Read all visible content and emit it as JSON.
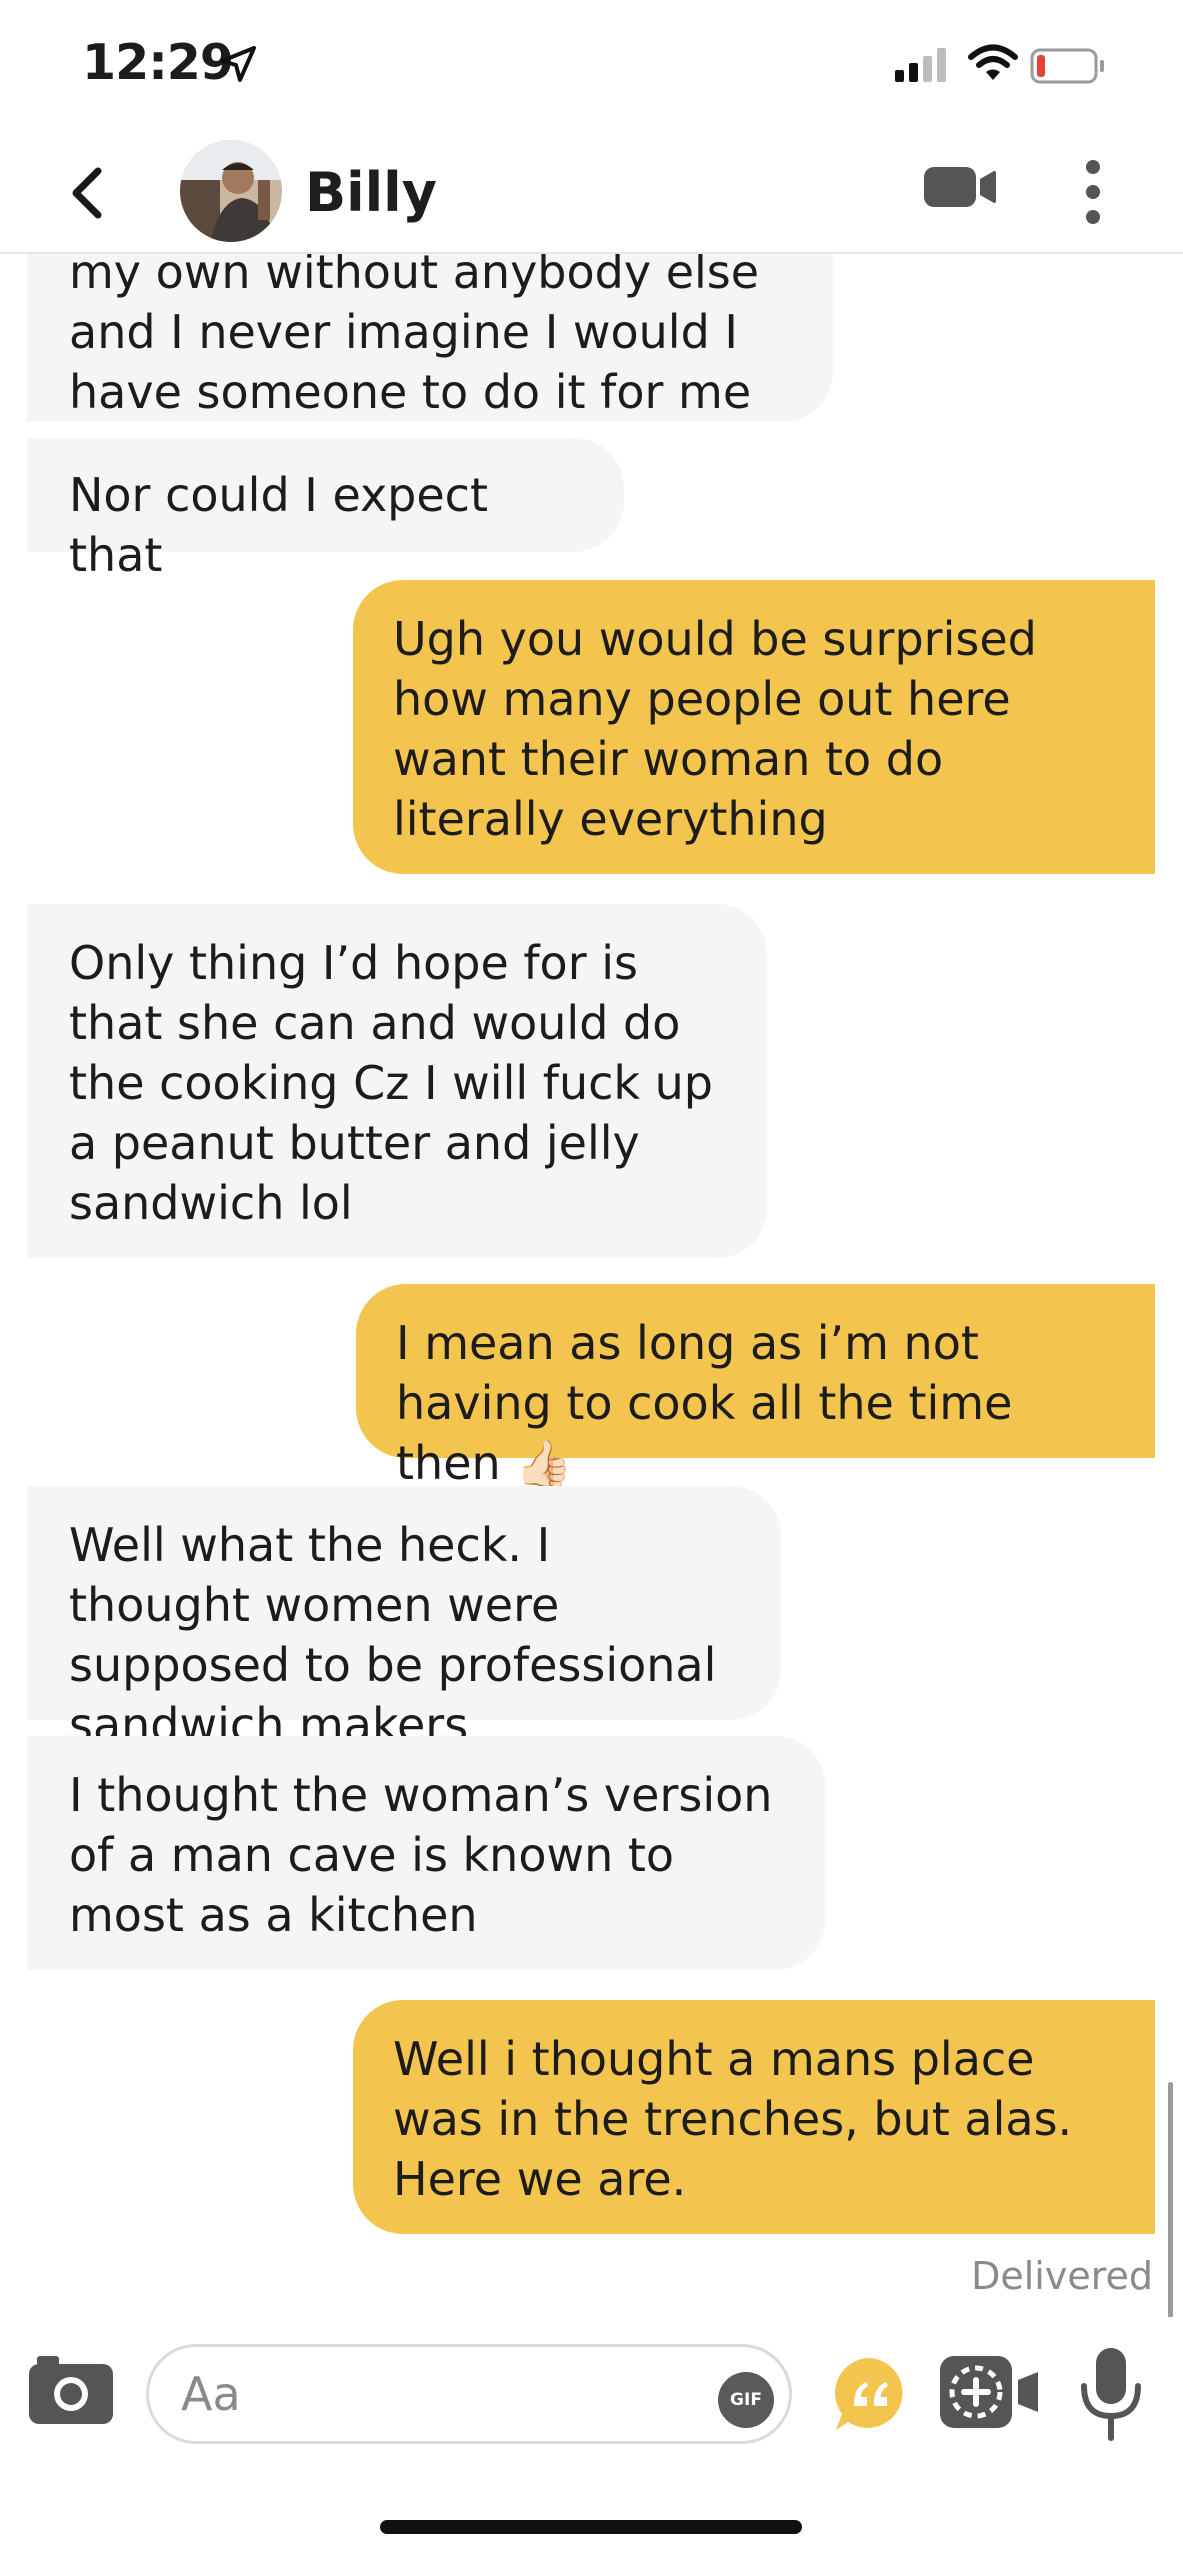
{
  "status_bar": {
    "time": "12:29",
    "icons": [
      "location-arrow-icon",
      "cellular-signal-icon",
      "wifi-icon",
      "battery-low-icon"
    ],
    "battery_color": "#e5433a"
  },
  "header": {
    "contact_name": "Billy",
    "icons": [
      "back-chevron-icon",
      "video-call-icon",
      "more-vertical-icon"
    ]
  },
  "messages": [
    {
      "from": "them",
      "text": "my own without anybody else and I never imagine I would I have someone to do it for me"
    },
    {
      "from": "them",
      "text": "Nor could I expect that"
    },
    {
      "from": "me",
      "text": "Ugh you would be surprised how many people out here want their woman to do literally everything"
    },
    {
      "from": "them",
      "text": "Only thing I’d hope for is that she can and would do the cooking Cz I will fuck up a peanut butter and jelly sandwich lol"
    },
    {
      "from": "me",
      "text": "I mean as long as i’m not having to cook all the time then 👍🏻"
    },
    {
      "from": "them",
      "text": "Well what the heck. I thought women were supposed to be professional sandwich makers"
    },
    {
      "from": "them",
      "text": "I thought the woman’s version of a man cave is known to most as a kitchen"
    },
    {
      "from": "me",
      "text": "Well i thought a mans place was in the trenches, but alas. Here we are."
    }
  ],
  "delivered_label": "Delivered",
  "composer": {
    "placeholder": "Aa",
    "value": "",
    "gif_label": "GIF",
    "icons": [
      "camera-icon",
      "gif-icon",
      "quote-icon",
      "video-note-icon",
      "microphone-icon"
    ]
  },
  "colors": {
    "outgoing_bubble": "#f4c54e",
    "incoming_bubble": "#f5f5f5",
    "accent": "#f4c54e"
  }
}
